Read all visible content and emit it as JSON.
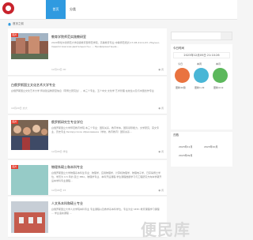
{
  "header": {
    "nav_home": "首页",
    "nav_category": "分类"
  },
  "breadcrumb": {
    "label": "首页之前"
  },
  "articles": [
    {
      "tag": "图片",
      "title": "教育学院师范实践教研室",
      "summary": "2020年哈尔滨师范大学初级教育部师范学院，高等教育专业·中等师范培训·17-08-2111-03 «Научно-педагогическая деятельность» ... Профориентация...",
      "meta": "12月10日 00",
      "views": "● 阅"
    },
    {
      "tag": "",
      "title": "白俄罗斯国立文化艺术大学专业",
      "summary": "白俄罗斯国立文化艺术大学 师资建设教研室信息（带博士研究生），本三个专业、五个中文 文化学 艺术管理 在校生以及与中国合作专业",
      "meta": "10月20日 文大",
      "views": "● 阅"
    },
    {
      "tag": "图片",
      "title": "俄罗斯研究生专业学位",
      "summary": "白俄罗斯国立大学师范教育学院 本三个专业：国际关系，教育学本，国际领导能力，文学研究、英文专业、历史专业 белорусское образование（学校、教育教育）国际关系...",
      "meta": "12月08日 学位",
      "views": "● 阅"
    },
    {
      "tag": "图片",
      "title": "物理系硕士和本科专业",
      "summary": "白俄罗斯国立大学物理系本科生专业：物理学、应用物理学、计算机物理学、物理电子学，已获得博士学位，学历为 0.5 年的 硕士 MBA，物理学专业、本科开设课程·学生课程数据学习与工程研究方向本学期开设本学科专业课程...",
      "meta": "12月08日 15",
      "views": "● 阅"
    },
    {
      "tag": "",
      "title": "人文系本科和硕士专业",
      "summary": "白俄罗斯国立大学人文学院本科专业 专业课程以及教学系本科学位，专业为全 SEPC 教育课程学习课程 ... 学业语言课程 ...",
      "meta": "",
      "views": ""
    }
  ],
  "sidebar": {
    "search_placeholder": "",
    "time_title": "今日时间",
    "clock": "2023年12月05日 21:10:26",
    "stats": [
      {
        "label": "今日",
        "value": "更新42篇",
        "color": "#e9733f"
      },
      {
        "label": "本周",
        "value": "更新1.2k",
        "color": "#49b6d6"
      },
      {
        "label": "本月",
        "value": "更新4.1k",
        "color": "#5cb85c"
      }
    ],
    "archive_title": "归档",
    "archives": [
      "2023年11月",
      "2023年10月",
      "2023年09月"
    ]
  },
  "watermark": "便民库"
}
